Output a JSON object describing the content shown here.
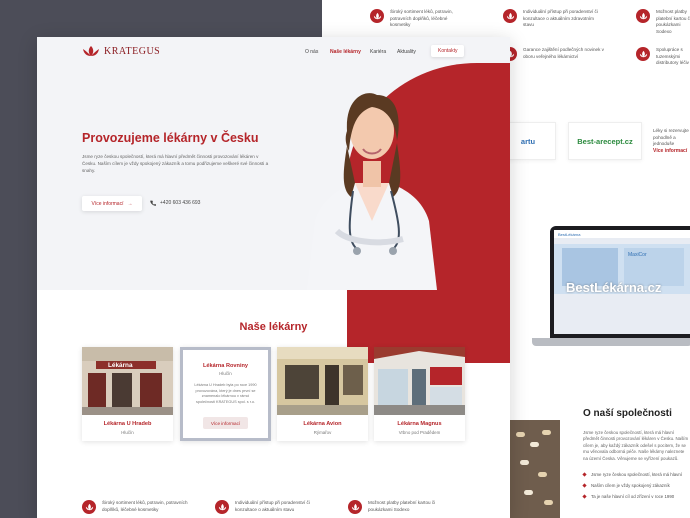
{
  "back_features_top": [
    {
      "text": "Široký sortiment léků, potravin, potravních doplňků, léčebné kosmetiky"
    },
    {
      "text": "Individuální přístup při poradenství či konzultace o aktuálním zdravotním stavu"
    },
    {
      "text": "Možnost platby platební kartou či poukázkami Sodexo"
    }
  ],
  "back_features_second": [
    {
      "text": "Garance zajištění podlečných novinek v oboru veřejného lékárnictví"
    },
    {
      "text": "Spolupráce s tuzemskými distributory léčiv"
    }
  ],
  "partners": {
    "partner1_text": "artu",
    "partner2_text": "Best-arecept.cz",
    "description": "Léky si rezervujte pohodlně a jednoduše",
    "link": "Více informací"
  },
  "laptop": {
    "bar_text": "BestLékárna",
    "brand": "BestLékárna.cz",
    "secondary": "MaxiCor"
  },
  "about": {
    "title": "O naší společnosti",
    "text": "Jsme ryze českou společností, která má hlavní předmět činnosti provozování lékáren v Česku. Naším cílem je, aby každý zákazník odešel s pocitem, že se mu věnovala odborná péče. Naše lékárny naleznete na území Česka. Věnujeme se vyřízení poukazů.",
    "items": [
      "Jsme ryze českou společností, která má hlavní",
      "Naším cílem je vždy spokojený zákazník",
      "Ta je naše hlavní cíl od zřízení v roce 1990"
    ]
  },
  "nav": {
    "logo": "KRATEGUS",
    "items": [
      "O nás",
      "Naše lékárny",
      "Kariéra",
      "Aktuality"
    ],
    "contact": "Kontakty"
  },
  "hero": {
    "title": "Provozujeme lékárny v Česku",
    "text": "Jsme ryze českou společností, která má hlavní předmět činnosti provozování lékáren v Česku. Naším cílem je vždy spokojený zákazník a tomu podřizujeme veškeré své činnosti a snahy.",
    "button": "Více informací",
    "phone": "+420 603 436 693"
  },
  "pharmacies": {
    "title": "Naše lékárny",
    "cards": [
      {
        "name": "Lékárna U Hradeb",
        "city": "Hlučín",
        "sign": "Lékárna"
      },
      {
        "name": "Lékárna Rovniny",
        "city": "Hlučín",
        "desc": "Lékárna U Hradeb byla po roce 1990 provozována, který je dnes první se znamenalo lékárnou v rámci společnosti KRATEGUS spol. s r.o.",
        "button": "Více informací"
      },
      {
        "name": "Lékárna Avion",
        "city": "Rýmařov"
      },
      {
        "name": "Lékárna Magnus",
        "city": "Vrbno pod Pradědem"
      }
    ]
  },
  "bottom_features": [
    {
      "text": "Široký sortiment léků, potravin, potravních doplňků, léčebné kosmetiky"
    },
    {
      "text": "Individuální přístup při poradenství či konzultace o aktuálním stavu"
    },
    {
      "text": "Možnost platby platební kartou či poukázkami Sodexo"
    }
  ],
  "colors": {
    "accent": "#b5252a",
    "dark_strip": "#4c4d58",
    "hero_bg": "#f3f4f7"
  }
}
